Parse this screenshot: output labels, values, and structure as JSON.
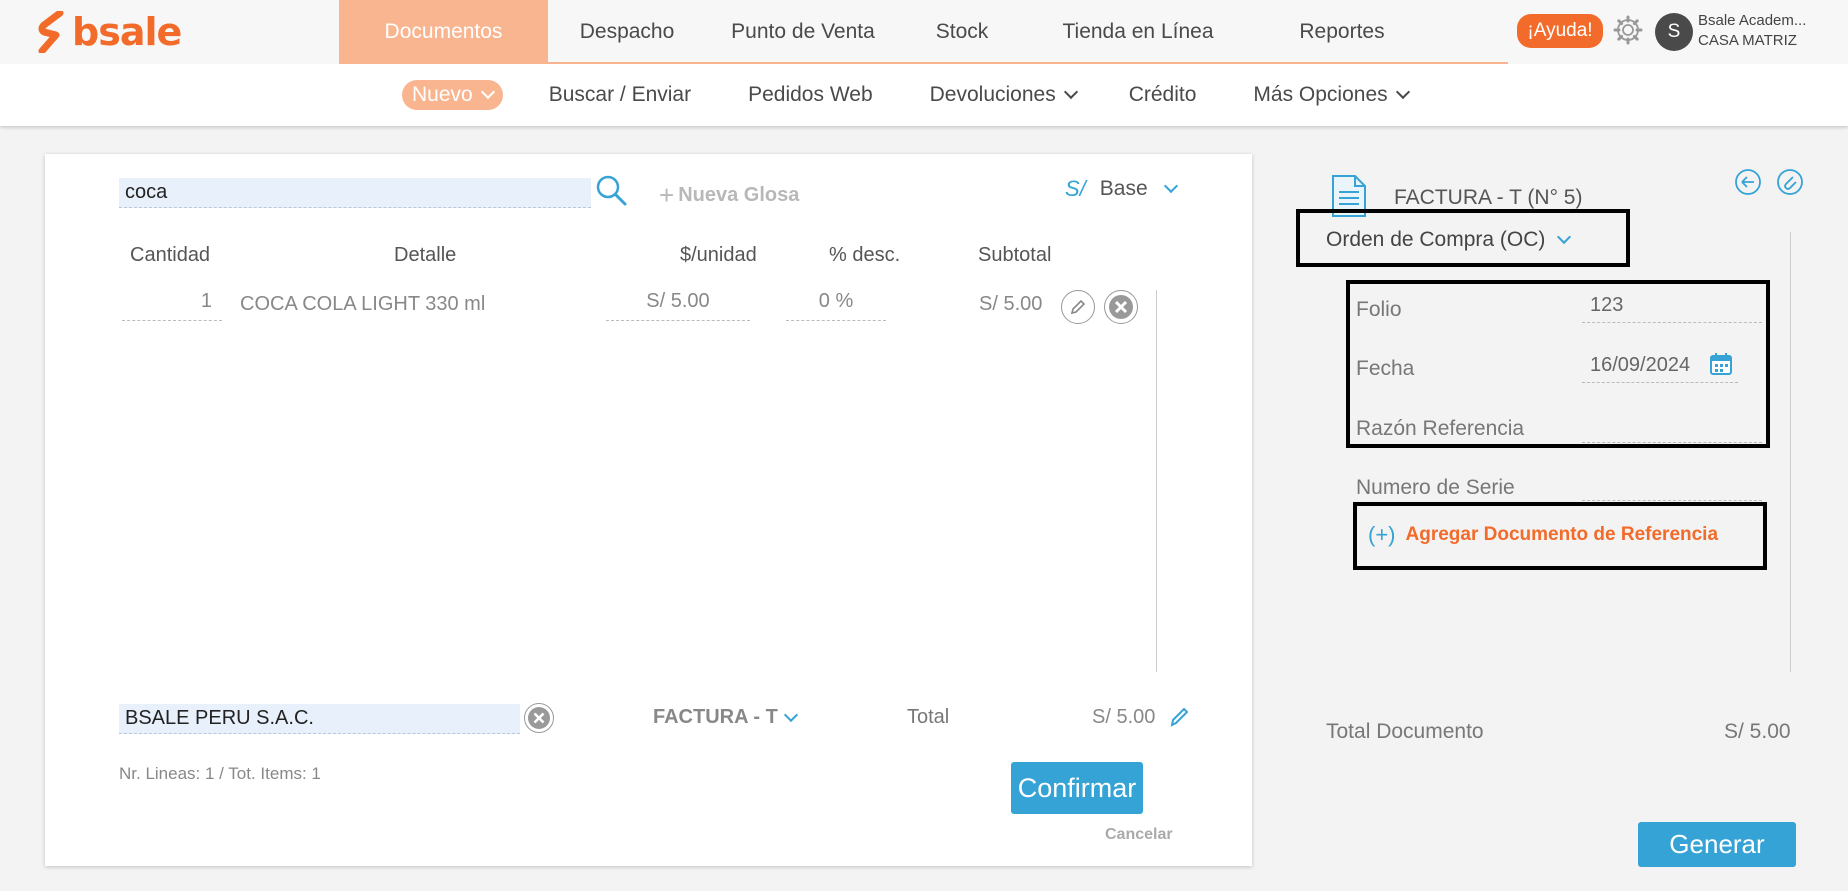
{
  "brand": {
    "logo_text": "bsale",
    "accent": "#f26b2a",
    "nav_active_bg": "#f9b58f",
    "primary_blue": "#35a3d6"
  },
  "main_nav": {
    "items": [
      {
        "label": "Documentos",
        "active": true
      },
      {
        "label": "Despacho"
      },
      {
        "label": "Punto de Venta"
      },
      {
        "label": "Stock"
      },
      {
        "label": "Tienda en Línea"
      },
      {
        "label": "Reportes"
      }
    ],
    "help_label": "¡Ayuda!",
    "settings_icon": "gear-icon"
  },
  "user": {
    "avatar_letter": "S",
    "name": "Bsale Academ...",
    "branch": "CASA MATRIZ"
  },
  "sub_nav": {
    "items": [
      {
        "label": "Nuevo",
        "active": true,
        "dropdown": true
      },
      {
        "label": "Buscar / Enviar"
      },
      {
        "label": "Pedidos Web"
      },
      {
        "label": "Devoluciones",
        "dropdown": true
      },
      {
        "label": "Crédito"
      },
      {
        "label": "Más Opciones",
        "dropdown": true
      }
    ]
  },
  "editor": {
    "search_value": "coca",
    "new_glosa_label": "Nueva Glosa",
    "currency_symbol": "S/",
    "price_list": "Base",
    "columns": [
      "Cantidad",
      "Detalle",
      "$/unidad",
      "% desc.",
      "Subtotal"
    ],
    "rows": [
      {
        "quantity": "1",
        "detail": "COCA COLA LIGHT 330 ml",
        "unit_price": "S/ 5.00",
        "discount": "0 %",
        "subtotal": "S/ 5.00"
      }
    ],
    "client_value": "BSALE PERU S.A.C.",
    "document_type": "FACTURA - T",
    "total_label": "Total",
    "total_value": "S/ 5.00",
    "lines_summary": "Nr. Lineas: 1 / Tot. Items: 1",
    "confirm_label": "Confirmar",
    "cancel_label": "Cancelar"
  },
  "reference_panel": {
    "title": "FACTURA - T (N° 5)",
    "reference_type": "Orden de Compra (OC)",
    "folio_label": "Folio",
    "folio_value": "123",
    "date_label": "Fecha",
    "date_value": "16/09/2024",
    "reason_label": "Razón Referencia",
    "reason_value": "",
    "serial_label": "Numero de Serie",
    "add_ref_symbol": "(+)",
    "add_ref_label": "Agregar Documento de Referencia",
    "total_doc_label": "Total Documento",
    "total_doc_value": "S/ 5.00",
    "generate_label": "Generar"
  }
}
